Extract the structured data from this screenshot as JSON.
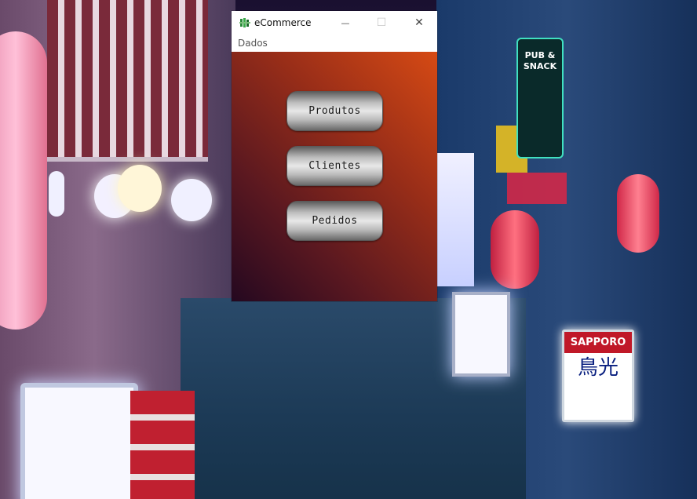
{
  "window": {
    "title": "eCommerce",
    "controls": {
      "minimize_glyph": "—",
      "maximize_glyph": "☐",
      "close_glyph": "✕"
    }
  },
  "menu": {
    "items": [
      {
        "label": "Dados"
      }
    ]
  },
  "main": {
    "buttons": [
      {
        "label": "Produtos"
      },
      {
        "label": "Clientes"
      },
      {
        "label": "Pedidos"
      }
    ]
  },
  "wallpaper": {
    "signs": {
      "pub": "PUB & SNACK",
      "sapporo_top": "SAPPORO",
      "sapporo_kanji": "鳥光"
    }
  },
  "colors": {
    "client_gradient_top": "#d64a14",
    "client_gradient_bottom": "#240820",
    "button_silver": "#e8e8e8"
  }
}
